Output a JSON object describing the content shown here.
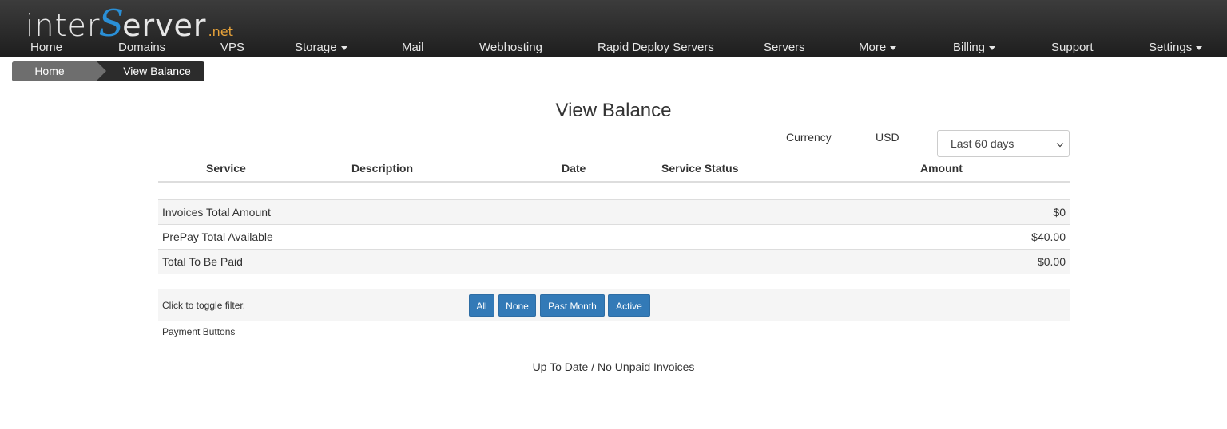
{
  "logo": {
    "part1": "inter",
    "part2": "S",
    "part3": "erver",
    "suffix": ".net"
  },
  "nav": [
    {
      "label": "Home",
      "dropdown": false
    },
    {
      "label": "Domains",
      "dropdown": false
    },
    {
      "label": "VPS",
      "dropdown": false
    },
    {
      "label": "Storage",
      "dropdown": true
    },
    {
      "label": "Mail",
      "dropdown": false
    },
    {
      "label": "Webhosting",
      "dropdown": false
    },
    {
      "label": "Rapid Deploy Servers",
      "dropdown": false
    },
    {
      "label": "Servers",
      "dropdown": false
    },
    {
      "label": "More",
      "dropdown": true
    },
    {
      "label": "Billing",
      "dropdown": true
    },
    {
      "label": "Support",
      "dropdown": false
    },
    {
      "label": "Settings",
      "dropdown": true
    }
  ],
  "breadcrumb": {
    "home": "Home",
    "current": "View Balance"
  },
  "page": {
    "title": "View Balance"
  },
  "currency": {
    "label": "Currency",
    "value": "USD"
  },
  "range_select": {
    "selected": "Last 60 days"
  },
  "table": {
    "headers": [
      "Service",
      "Description",
      "Date",
      "Service Status",
      "Amount"
    ],
    "summary": [
      {
        "label": "Invoices Total Amount",
        "amount": "$0"
      },
      {
        "label": "PrePay Total Available",
        "amount": "$40.00"
      },
      {
        "label": "Total To Be Paid",
        "amount": "$0.00"
      }
    ]
  },
  "filter": {
    "label": "Click to toggle filter.",
    "buttons": [
      "All",
      "None",
      "Past Month",
      "Active"
    ]
  },
  "payment": {
    "label": "Payment Buttons",
    "status": "Up To Date / No Unpaid Invoices"
  },
  "colors": {
    "nav_bg": "#2a2a2a",
    "accent_blue": "#337ab7",
    "logo_blue": "#2a8fd6",
    "logo_orange": "#e8a33a"
  }
}
